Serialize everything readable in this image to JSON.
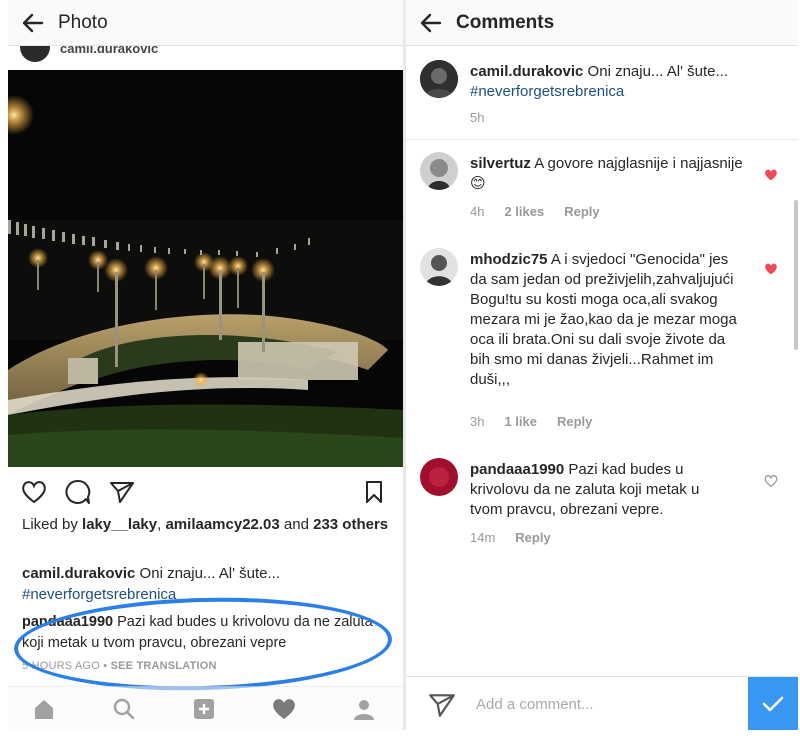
{
  "photo_screen": {
    "title": "Photo",
    "post_username_clipped": "camil.durakovic",
    "liked_by_prefix": "Liked by ",
    "liked_user_1": "laky__laky",
    "liked_sep": ", ",
    "liked_user_2": "amilaamcy22.03",
    "liked_and": " and ",
    "liked_others": "233 others",
    "caption_user": "camil.durakovic",
    "caption_text": " Oni znaju... Al' šute...",
    "caption_hashtag": "#neverforgetsrebrenica",
    "comment_user": "pandaaa1990",
    "comment_text": " Pazi kad budes u krivolovu da ne zaluta koji metak u tvom pravcu, obrezani vepre",
    "comment_time": "5 HOURS AGO",
    "comment_dot": " • ",
    "see_translation": "SEE TRANSLATION"
  },
  "comments_screen": {
    "title": "Comments",
    "comments": [
      {
        "user": "camil.durakovic",
        "text": " Oni znaju... Al' šute...",
        "hashtag": "#neverforgetsrebrenica",
        "time": "5h"
      },
      {
        "user": "silvertuz",
        "text": " A govore najglasnije i najjasnije 😊",
        "time": "4h",
        "likes": "2 likes",
        "reply": "Reply",
        "liked": true
      },
      {
        "user": "mhodzic75",
        "text": " A i svjedoci \"Genocida\" jes da sam jedan od preživjelih,zahvaljujući Bogu!tu su kosti moga oca,ali svakog mezara mi je žao,kao da je mezar moga oca ili brata.Oni su dali svoje živote da bih smo mi danas živjeli...Rahmet im duši,,,",
        "time": "3h",
        "likes": "1 like",
        "reply": "Reply",
        "liked": true
      },
      {
        "user": "pandaaa1990",
        "text": " Pazi kad budes u krivolovu da ne zaluta koji metak u tvom pravcu, obrezani vepre.",
        "time": "14m",
        "reply": "Reply",
        "liked": false
      }
    ],
    "composer_placeholder": "Add a comment..."
  },
  "colors": {
    "accent": "#3897f0",
    "hashtag": "#1f4f7c",
    "heart_liked": "#ed4956",
    "highlight": "#2b7fe8"
  },
  "icons": [
    "back-arrow-icon",
    "heart-icon",
    "comment-icon",
    "share-icon",
    "bookmark-icon",
    "home-icon",
    "search-icon",
    "add-icon",
    "activity-icon",
    "profile-icon",
    "send-icon",
    "check-icon"
  ]
}
